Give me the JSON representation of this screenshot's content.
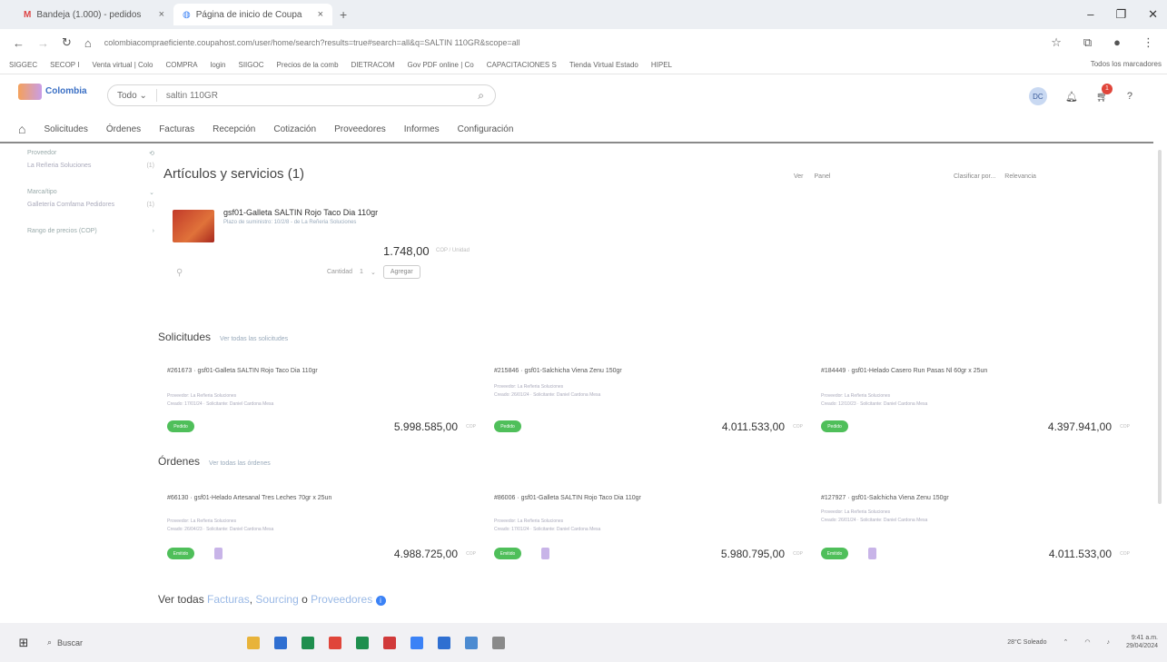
{
  "browser": {
    "tabs": [
      {
        "label": "Bandeja (1.000) - pedidos",
        "active": false
      },
      {
        "label": "Página de inicio de Coupa",
        "active": true
      }
    ],
    "url": "colombiacompraeficiente.coupahost.com/user/home/search?results=true#search=all&q=SALTIN 110GR&scope=all",
    "bookmarks": [
      "SIGGEC",
      "SECOP I",
      "Venta virtual | Colo",
      "COMPRA",
      "login",
      "SIIGOC",
      "Precios de la comb",
      "DIETRACOM",
      "Gov PDF online | Co",
      "CAPACITACIONES S",
      "Tienda Virtual Estado",
      "HIPEL"
    ],
    "bookmarks_right": "Todos los marcadores"
  },
  "app": {
    "logo_text": "Colombia",
    "search_scope": "Todo",
    "search_query": "saltin 110GR",
    "avatar_initials": "DC",
    "cart_count": "1",
    "help": "?",
    "nav": [
      "Solicitudes",
      "Órdenes",
      "Facturas",
      "Recepción",
      "Cotización",
      "Proveedores",
      "Informes",
      "Configuración"
    ]
  },
  "sidebar": {
    "sections": [
      {
        "title": "Proveedor",
        "item": "La Reñeria Soluciones",
        "count": "(1)"
      },
      {
        "title": "Marca/tipo",
        "item": "Galletería Comfama Pedidores",
        "count": "(1)"
      },
      {
        "title": "Rango de precios (COP)",
        "item": "",
        "count": ""
      }
    ]
  },
  "main": {
    "heading": "Artículos y servicios (1)",
    "view_label": "Ver",
    "view_value": "Panel",
    "sort_label": "Clasificar por...",
    "sort_value": "Relevancia",
    "product": {
      "title": "gsf01-Galleta SALTIN Rojo Taco Dia 110gr",
      "subtitle": "Plazo de suministro: 10/2/8 - de La Reñeria Soluciones",
      "price": "1.748,00",
      "unit": "COP / Unidad",
      "qty_label": "Cantidad",
      "qty_value": "1",
      "add_label": "Agregar"
    },
    "solicitudes": {
      "title": "Solicitudes",
      "link": "Ver todas las solicitudes",
      "cards": [
        {
          "head": "#261673 · gsf01-Galleta SALTIN Rojo Taco Dia 110gr",
          "line1": "Proveedor: La Reñeria Soluciones",
          "line2": "Creado: 17/01/24 · Solicitante: Daniel Cardona Mesa",
          "status": "Pedido",
          "amount": "5.998.585,00"
        },
        {
          "head": "#215846 · gsf01-Salchicha Viena Zenu 150gr",
          "line1": "Proveedor: La Reñeria Soluciones",
          "line2": "Creado: 26/01/24 · Solicitante: Daniel Cardona Mesa",
          "status": "Pedido",
          "amount": "4.011.533,00"
        },
        {
          "head": "#184449 · gsf01-Helado Casero Run Pasas Nl 60gr x 25un",
          "line1": "Proveedor: La Reñeria Soluciones",
          "line2": "Creado: 12/10/23 · Solicitante: Daniel Cardona Mesa",
          "status": "Pedido",
          "amount": "4.397.941,00"
        }
      ]
    },
    "ordenes": {
      "title": "Órdenes",
      "link": "Ver todas las órdenes",
      "cards": [
        {
          "head": "#66130 · gsf01-Helado Artesanal Tres Leches 70gr x 25un",
          "line1": "Proveedor: La Reñeria Soluciones",
          "line2": "Creado: 26/04/23 · Solicitante: Daniel Cardona Mesa",
          "status": "Emitido",
          "amount": "4.988.725,00"
        },
        {
          "head": "#86006 · gsf01-Galleta SALTIN Rojo Taco Dia 110gr",
          "line1": "Proveedor: La Reñeria Soluciones",
          "line2": "Creado: 17/01/24 · Solicitante: Daniel Cardona Mesa",
          "status": "Emitido",
          "amount": "5.980.795,00"
        },
        {
          "head": "#127927 · gsf01-Salchicha Viena Zenu 150gr",
          "line1": "Proveedor: La Reñeria Soluciones",
          "line2": "Creado: 26/01/24 · Solicitante: Daniel Cardona Mesa",
          "status": "Emitido",
          "amount": "4.011.533,00"
        }
      ]
    },
    "amount_unit": "COP",
    "footer": {
      "prefix": "Ver todas",
      "link1": "Facturas",
      "sep1": ",",
      "link2": "Sourcing",
      "sep2": "o",
      "link3": "Proveedores"
    }
  },
  "taskbar": {
    "search": "Buscar",
    "weather": "28°C Soleado",
    "time": "9:41 a.m.",
    "date": "29/04/2024"
  }
}
